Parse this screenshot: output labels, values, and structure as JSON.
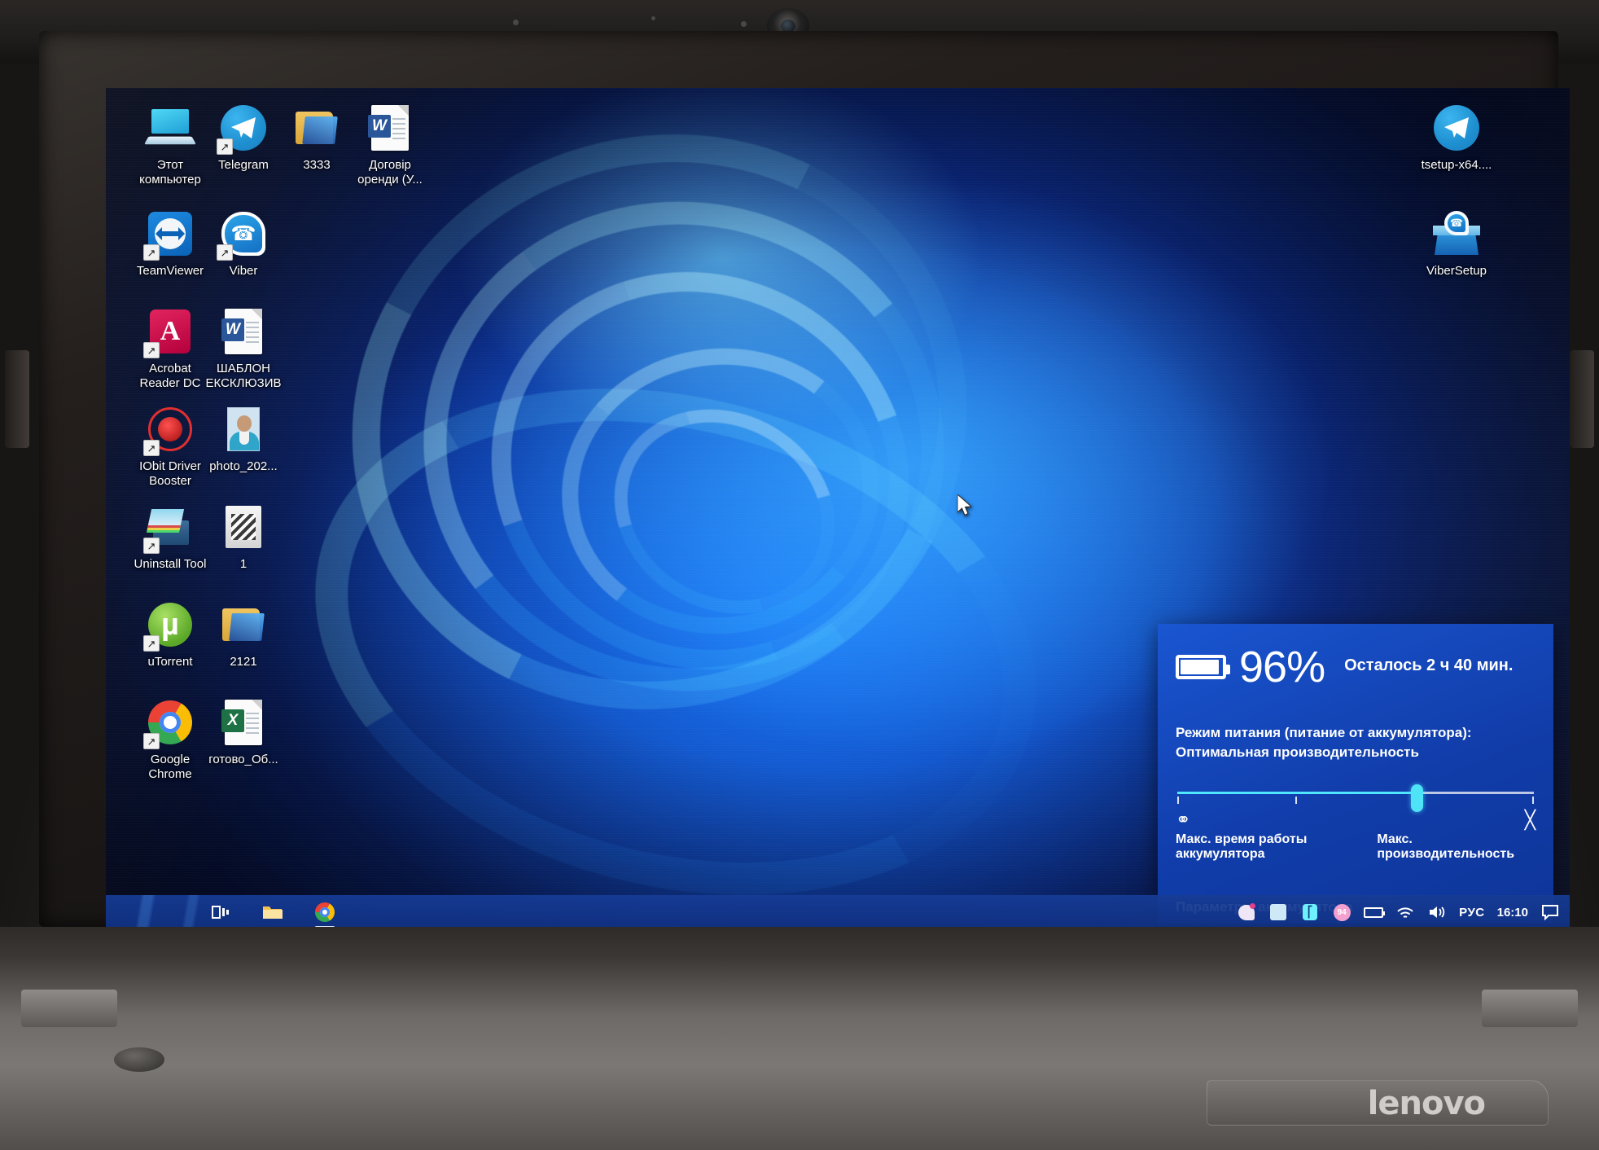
{
  "device": {
    "brand_logo": "lenovo"
  },
  "desktop": {
    "left_icons": [
      {
        "label": "Этот\nкомпьютер",
        "icon": "this-pc-icon",
        "shortcut": false
      },
      {
        "label": "Telegram",
        "icon": "telegram-icon",
        "shortcut": true
      },
      {
        "label": "3333",
        "icon": "folder-icon",
        "shortcut": false
      },
      {
        "label": "Договір\nоренди (У...",
        "icon": "word-document-icon",
        "shortcut": false
      },
      {
        "label": "TeamViewer",
        "icon": "teamviewer-icon",
        "shortcut": true
      },
      {
        "label": "Viber",
        "icon": "viber-icon",
        "shortcut": true
      },
      {
        "label": "Acrobat\nReader DC",
        "icon": "acrobat-reader-icon",
        "shortcut": true
      },
      {
        "label": "ШАБЛОН\nЕКСКЛЮЗИВ",
        "icon": "word-document-icon",
        "shortcut": false
      },
      {
        "label": "IObit Driver\nBooster",
        "icon": "iobit-driver-booster-icon",
        "shortcut": true
      },
      {
        "label": "photo_202...",
        "icon": "photo-thumbnail-icon",
        "shortcut": false
      },
      {
        "label": "Uninstall Tool",
        "icon": "uninstall-tool-icon",
        "shortcut": true
      },
      {
        "label": "1",
        "icon": "winrar-archive-icon",
        "shortcut": false
      },
      {
        "label": "uTorrent",
        "icon": "utorrent-icon",
        "shortcut": true
      },
      {
        "label": "2121",
        "icon": "folder-icon",
        "shortcut": false
      },
      {
        "label": "Google\nChrome",
        "icon": "google-chrome-icon",
        "shortcut": true
      },
      {
        "label": "готово_Об...",
        "icon": "excel-document-icon",
        "shortcut": false
      }
    ],
    "right_icons": [
      {
        "label": "tsetup-x64....",
        "icon": "telegram-setup-icon",
        "shortcut": false
      },
      {
        "label": "ViberSetup",
        "icon": "viber-setup-icon",
        "shortcut": false
      }
    ]
  },
  "battery_flyout": {
    "percent": "96%",
    "percent_value": 96,
    "remaining": "Осталось 2 ч 40 мин.",
    "mode_title": "Режим питания (питание от аккумулятора):",
    "mode_value": "Оптимальная производительность",
    "slider": {
      "position_percent": 67,
      "ticks": 4
    },
    "left_icon": "leaf-icon",
    "right_icon": "lightning-bolt-icon",
    "left_label": "Макс. время работы аккумулятора",
    "right_label": "Макс. производительность",
    "settings_link": "Параметры аккумулятора",
    "accent_color": "#50e6ff",
    "panel_color": "#1a56d2"
  },
  "taskbar": {
    "buttons": [
      {
        "name": "task-view",
        "icon": "task-view-icon",
        "active": false
      },
      {
        "name": "file-explorer",
        "icon": "folder-icon",
        "active": false
      },
      {
        "name": "google-chrome",
        "icon": "chrome-icon",
        "active": true
      }
    ],
    "tray": [
      {
        "name": "viber",
        "icon": "viber-tray-icon",
        "badge": true
      },
      {
        "name": "onedrive-sync",
        "icon": "document-tray-icon"
      },
      {
        "name": "bluetooth",
        "icon": "bluetooth-icon"
      },
      {
        "name": "battery-status",
        "icon": "battery-round-icon",
        "badge_text": "94"
      },
      {
        "name": "battery",
        "icon": "battery-icon"
      },
      {
        "name": "network",
        "icon": "wifi-icon"
      },
      {
        "name": "volume",
        "icon": "speaker-icon"
      }
    ],
    "language": "РУС",
    "clock": "16:10",
    "notification_icon": "notification-chat-icon"
  }
}
